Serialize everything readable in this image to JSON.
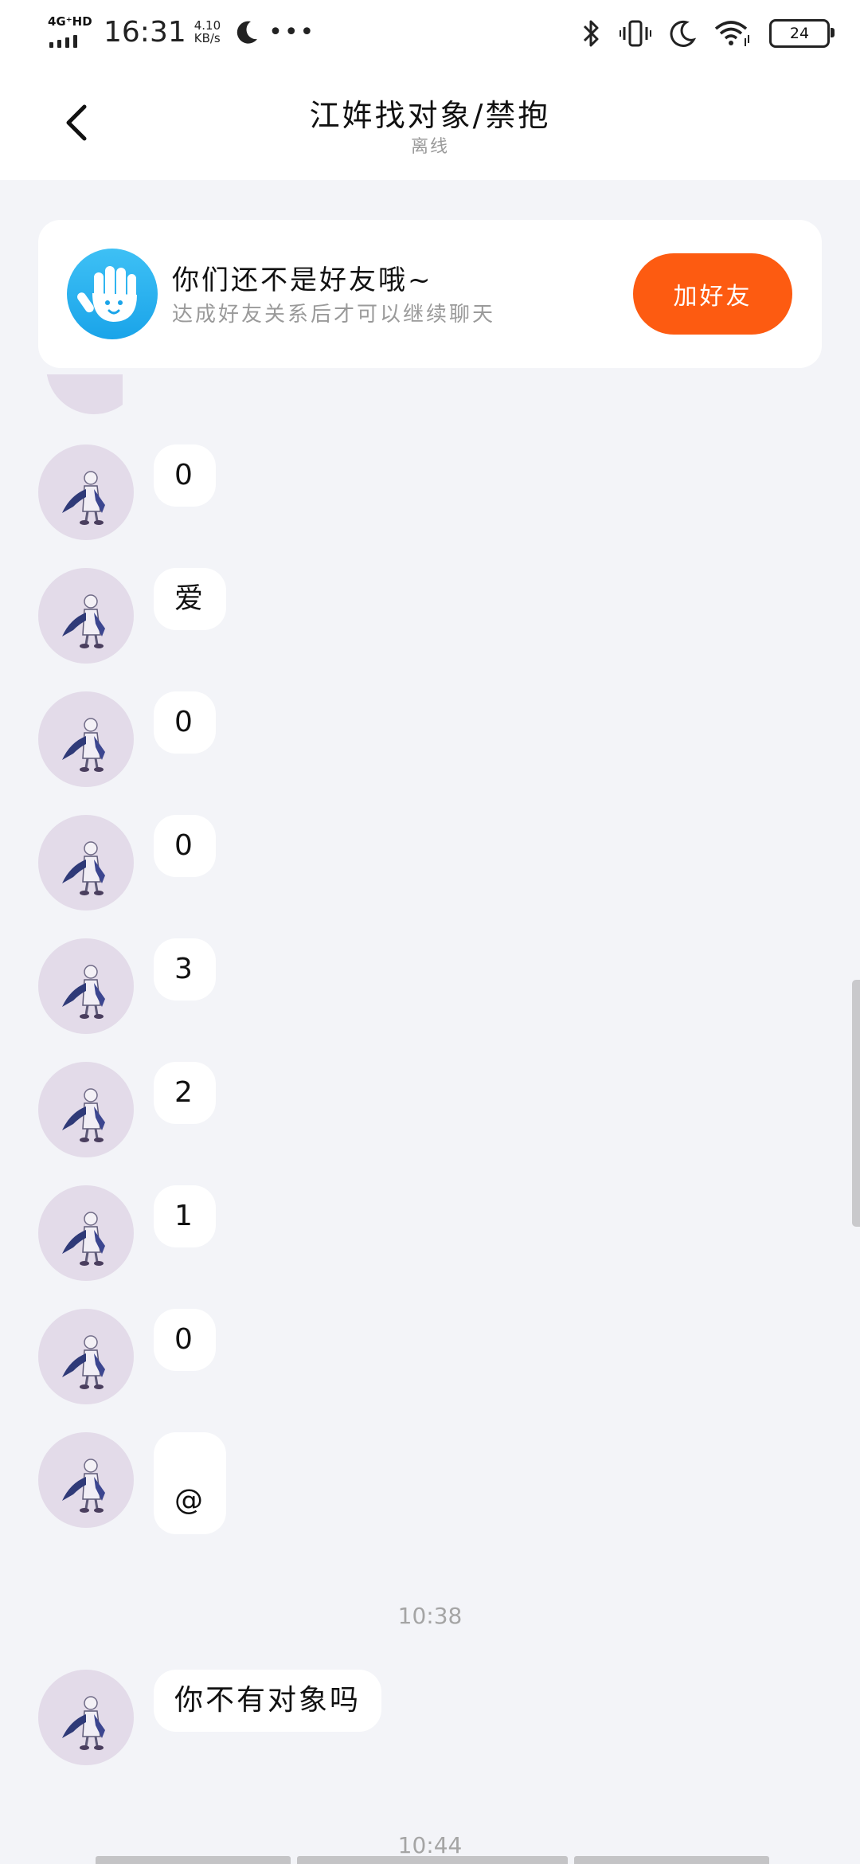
{
  "status_bar": {
    "network": "4G⁺HD",
    "time": "16:31",
    "speed_value": "4.10",
    "speed_unit": "KB/s",
    "battery": "24"
  },
  "header": {
    "title": "江姩找对象/禁抱",
    "subtitle": "离线"
  },
  "friend_prompt": {
    "title": "你们还不是好友哦~",
    "description": "达成好友关系后才可以继续聊天",
    "button_label": "加好友"
  },
  "messages": [
    {
      "text": "0"
    },
    {
      "text": "爱"
    },
    {
      "text": "0"
    },
    {
      "text": "0"
    },
    {
      "text": "3"
    },
    {
      "text": "2"
    },
    {
      "text": "1"
    },
    {
      "text": "0"
    },
    {
      "text": "@"
    }
  ],
  "time_separator_1": "10:38",
  "last_message": "你不有对象吗",
  "time_separator_2": "10:44",
  "colors": {
    "accent": "#fd5b11",
    "chat_background": "#f3f4f8",
    "avatar_background": "#e3dbe9"
  }
}
